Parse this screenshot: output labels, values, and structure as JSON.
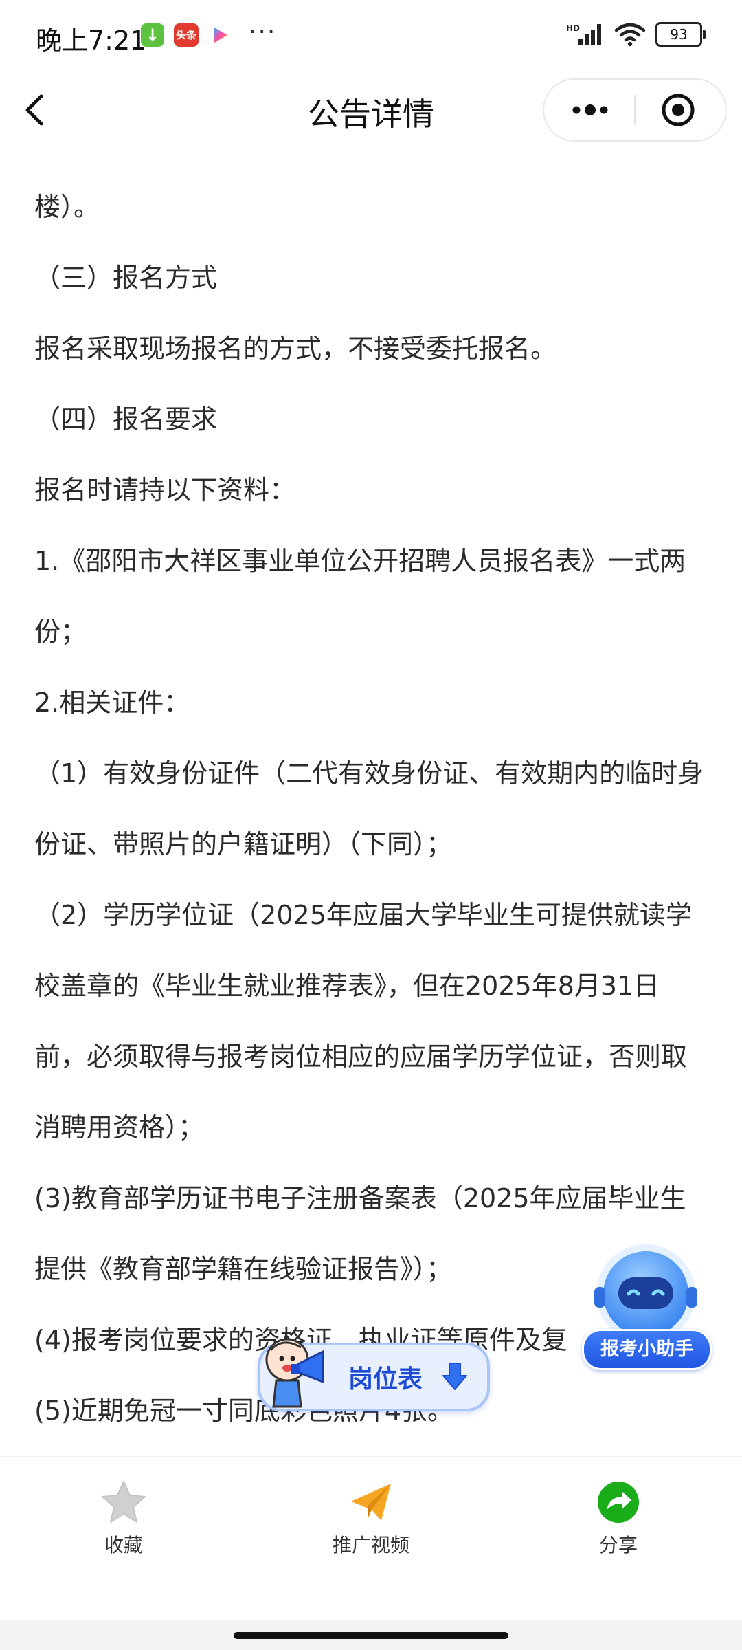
{
  "status_bar": {
    "time": "晚上7:21",
    "app_badge_news": "头条",
    "more": "···",
    "network": "HD",
    "battery": "93"
  },
  "nav": {
    "title": "公告详情"
  },
  "content": {
    "paragraphs": [
      "楼）。",
      "（三）报名方式",
      "报名采取现场报名的方式，不接受委托报名。",
      "（四）报名要求",
      "报名时请持以下资料：",
      "1.《邵阳市大祥区事业单位公开招聘人员报名表》一式两份；",
      "2.相关证件：",
      "（1）有效身份证件（二代有效身份证、有效期内的临时身份证、带照片的户籍证明）（下同）；",
      "（2）学历学位证（2025年应届大学毕业生可提供就读学校盖章的《毕业生就业推荐表》，但在2025年8月31日前，必须取得与报考岗位相应的应届学历学位证，否则取消聘用资格）；",
      "(3)教育部学历证书电子注册备案表（2025年应届毕业生提供《教育部学籍在线验证报告》）；",
      "(4)报考岗位要求的资格证、执业证等原件及复",
      "(5)近期免冠一寸同底彩色照片4张。"
    ]
  },
  "floating": {
    "helper_label": "报考小助手",
    "job_table_label": "岗位表"
  },
  "toolbar": {
    "favorite_label": "收藏",
    "promo_video_label": "推广视频",
    "share_label": "分享"
  },
  "colors": {
    "accent_blue": "#1e4bd6",
    "share_green": "#1aad19",
    "promo_orange": "#f5a623",
    "star_gray": "#d0d0d0"
  }
}
